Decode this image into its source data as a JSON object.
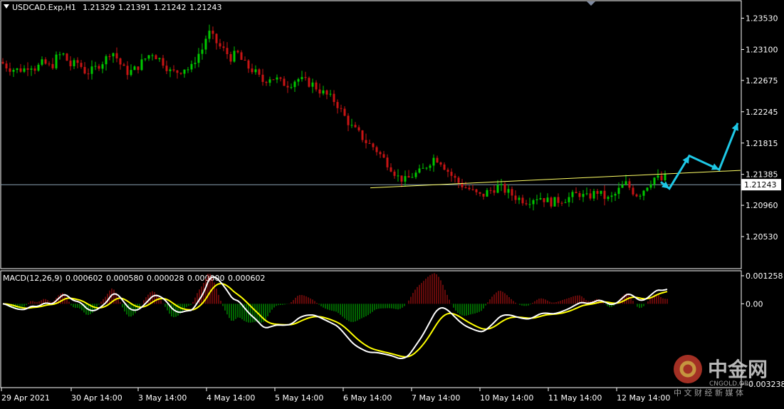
{
  "header": {
    "symbol": "USDCAD.Exp,H1",
    "open": "1.21329",
    "high": "1.21391",
    "low": "1.21242",
    "close": "1.21243"
  },
  "macd_header": {
    "name": "MACD(12,26,9)",
    "values": [
      "0.000602",
      "0.000580",
      "0.000028",
      "0.000000",
      "0.000602"
    ]
  },
  "colors": {
    "background": "#000000",
    "bull": "#00c800",
    "bear": "#c81414",
    "macd_line": "#ffffff",
    "signal_line": "#ffff00",
    "trendline": "#ffff66",
    "current_price_line": "#8aa0b0",
    "forecast_arrow": "#1ec8e6",
    "axis": "#ffffff"
  },
  "chart_data": [
    {
      "type": "candlestick",
      "title": "USDCAD.Exp,H1",
      "x_labels": [
        "29 Apr 2021",
        "30 Apr 14:00",
        "3 May 14:00",
        "4 May 14:00",
        "5 May 14:00",
        "6 May 14:00",
        "7 May 14:00",
        "10 May 14:00",
        "11 May 14:00",
        "12 May 14:00"
      ],
      "y_ticks": [
        "1.23530",
        "1.23100",
        "1.22675",
        "1.22245",
        "1.21815",
        "1.21385",
        "1.20960",
        "1.20530"
      ],
      "ylim": [
        1.201,
        1.2376
      ],
      "current_price": "1.21243",
      "close_path": [
        [
          0,
          1.2293
        ],
        [
          8,
          1.2285
        ],
        [
          16,
          1.2282
        ],
        [
          24,
          1.2283
        ],
        [
          30,
          1.229
        ],
        [
          36,
          1.2284
        ],
        [
          44,
          1.2292
        ],
        [
          52,
          1.2285
        ],
        [
          58,
          1.23
        ],
        [
          64,
          1.2304
        ],
        [
          72,
          1.2288
        ],
        [
          80,
          1.2292
        ],
        [
          88,
          1.2278
        ],
        [
          96,
          1.2282
        ],
        [
          102,
          1.229
        ],
        [
          108,
          1.2296
        ],
        [
          114,
          1.231
        ],
        [
          120,
          1.2298
        ],
        [
          126,
          1.2284
        ],
        [
          132,
          1.2278
        ],
        [
          140,
          1.2284
        ],
        [
          148,
          1.2296
        ],
        [
          156,
          1.2306
        ],
        [
          162,
          1.2299
        ],
        [
          168,
          1.2292
        ],
        [
          176,
          1.2278
        ],
        [
          184,
          1.228
        ],
        [
          190,
          1.2285
        ],
        [
          196,
          1.2282
        ],
        [
          202,
          1.23
        ],
        [
          208,
          1.231
        ],
        [
          214,
          1.2335
        ],
        [
          220,
          1.2324
        ],
        [
          226,
          1.2314
        ],
        [
          232,
          1.2307
        ],
        [
          238,
          1.2298
        ],
        [
          244,
          1.2306
        ],
        [
          250,
          1.2292
        ],
        [
          256,
          1.2285
        ],
        [
          262,
          1.228
        ],
        [
          270,
          1.2266
        ],
        [
          278,
          1.2272
        ],
        [
          284,
          1.227
        ],
        [
          290,
          1.2264
        ],
        [
          298,
          1.2262
        ],
        [
          306,
          1.227
        ],
        [
          314,
          1.2266
        ],
        [
          322,
          1.2262
        ],
        [
          330,
          1.2253
        ],
        [
          338,
          1.2246
        ],
        [
          346,
          1.2238
        ],
        [
          354,
          1.222
        ],
        [
          362,
          1.2204
        ],
        [
          370,
          1.2194
        ],
        [
          378,
          1.2182
        ],
        [
          386,
          1.2175
        ],
        [
          394,
          1.2162
        ],
        [
          402,
          1.215
        ],
        [
          410,
          1.2135
        ],
        [
          418,
          1.213
        ],
        [
          426,
          1.2138
        ],
        [
          434,
          1.2142
        ],
        [
          442,
          1.2154
        ],
        [
          448,
          1.2162
        ],
        [
          454,
          1.2157
        ],
        [
          460,
          1.2146
        ],
        [
          466,
          1.2136
        ],
        [
          472,
          1.2128
        ],
        [
          478,
          1.2122
        ],
        [
          484,
          1.2118
        ],
        [
          490,
          1.2112
        ],
        [
          496,
          1.2108
        ],
        [
          502,
          1.2114
        ],
        [
          508,
          1.2118
        ],
        [
          514,
          1.2122
        ],
        [
          520,
          1.2117
        ],
        [
          526,
          1.2112
        ],
        [
          532,
          1.2107
        ],
        [
          538,
          1.2104
        ],
        [
          544,
          1.2102
        ],
        [
          550,
          1.2106
        ],
        [
          556,
          1.2108
        ],
        [
          562,
          1.2104
        ],
        [
          568,
          1.21
        ],
        [
          574,
          1.2102
        ],
        [
          580,
          1.2104
        ],
        [
          586,
          1.2106
        ],
        [
          592,
          1.211
        ],
        [
          598,
          1.2112
        ],
        [
          604,
          1.2106
        ],
        [
          610,
          1.211
        ],
        [
          616,
          1.2115
        ],
        [
          622,
          1.2108
        ],
        [
          628,
          1.2104
        ],
        [
          634,
          1.211
        ],
        [
          640,
          1.212
        ],
        [
          646,
          1.2126
        ],
        [
          652,
          1.2116
        ],
        [
          658,
          1.211
        ],
        [
          664,
          1.2118
        ],
        [
          670,
          1.2128
        ],
        [
          676,
          1.2135
        ],
        [
          682,
          1.213
        ],
        [
          688,
          1.2136
        ]
      ],
      "trendline": {
        "from": [
          520,
          1.212
        ],
        "to": [
          1040,
          1.2144
        ]
      },
      "forecast_arrow": [
        [
          928,
          1.2128
        ],
        [
          940,
          1.2119
        ],
        [
          968,
          1.2164
        ],
        [
          1010,
          1.2145
        ],
        [
          1036,
          1.2209
        ]
      ]
    },
    {
      "type": "macd",
      "title": "MACD(12,26,9)",
      "params": [
        12,
        26,
        9
      ],
      "y_ticks": [
        "0.001258",
        "0.00",
        "-0.003238"
      ],
      "ylim": [
        -0.003238,
        0.001258
      ]
    }
  ],
  "watermark": {
    "brand": "中金网",
    "domain": "CNGOLD.ORG",
    "tagline": "中 文 财 经 新 媒 体"
  }
}
